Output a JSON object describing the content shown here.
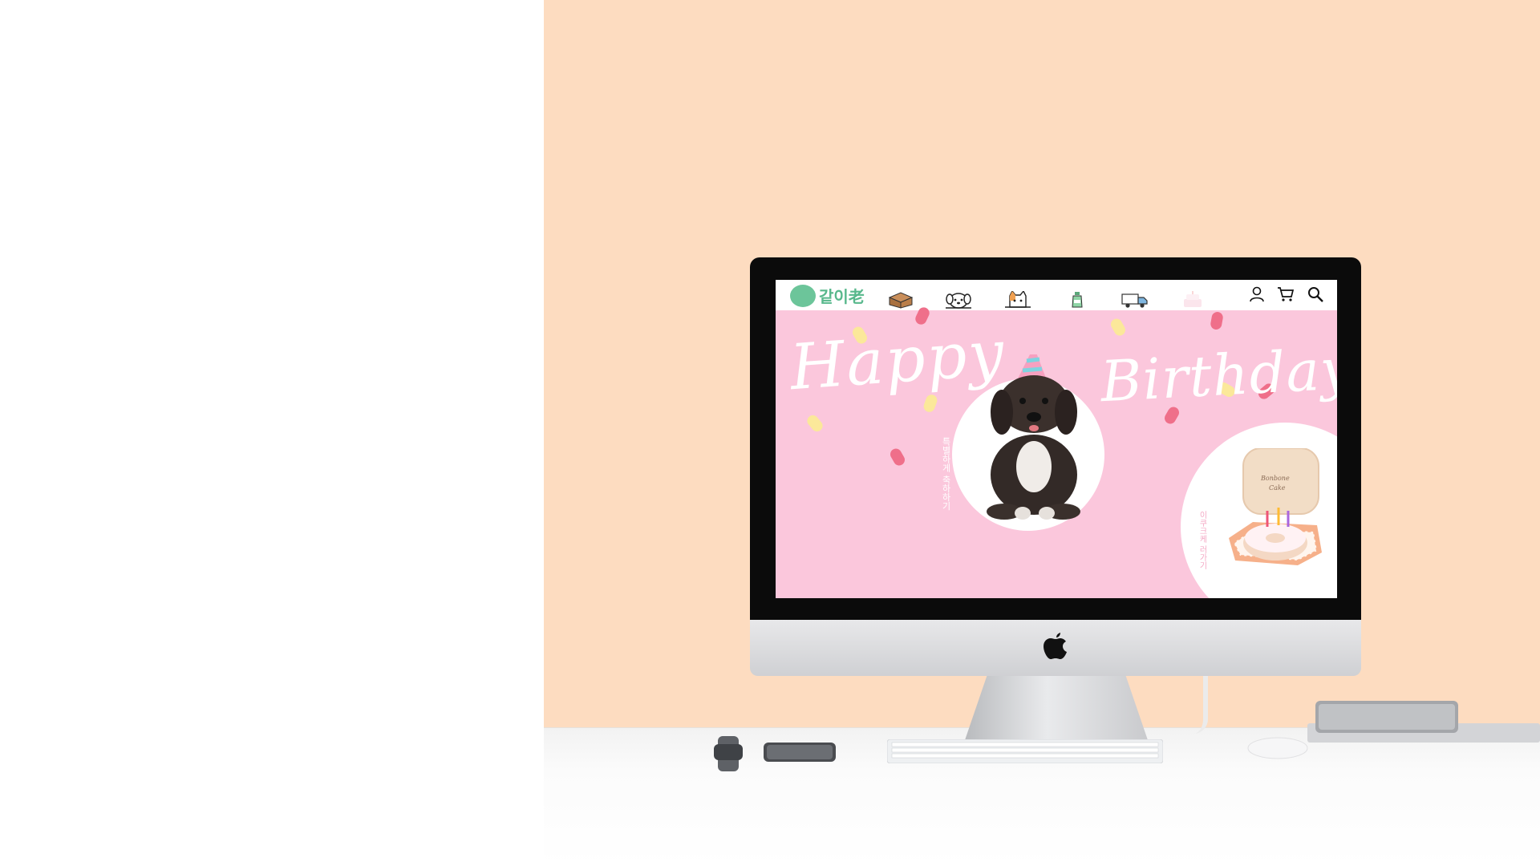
{
  "screen": {
    "brand_name": "같이老",
    "nav_icons": [
      "box-icon",
      "dog-icon",
      "cat-icon",
      "bottle-icon",
      "truck-icon",
      "cake-icon"
    ],
    "util_icons": [
      "user-icon",
      "cart-icon",
      "search-icon"
    ],
    "hero": {
      "happy_text": "Happy",
      "birthday_text": "Birthday",
      "vertical_left_text": "특별하게 축하하기",
      "vertical_right_text": "이쿠크케 러가기"
    },
    "colors": {
      "hero_bg": "#fbc7dc",
      "brand_green": "#58b88c",
      "wall": "#fddcc0"
    }
  }
}
